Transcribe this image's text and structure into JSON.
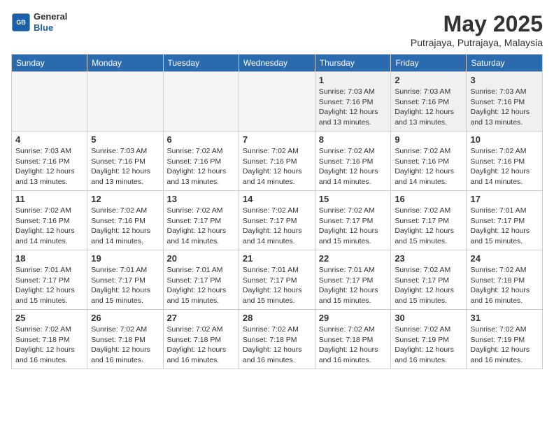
{
  "header": {
    "logo_general": "General",
    "logo_blue": "Blue",
    "month_title": "May 2025",
    "subtitle": "Putrajaya, Putrajaya, Malaysia"
  },
  "weekdays": [
    "Sunday",
    "Monday",
    "Tuesday",
    "Wednesday",
    "Thursday",
    "Friday",
    "Saturday"
  ],
  "weeks": [
    [
      {
        "day": "",
        "info": ""
      },
      {
        "day": "",
        "info": ""
      },
      {
        "day": "",
        "info": ""
      },
      {
        "day": "",
        "info": ""
      },
      {
        "day": "1",
        "info": "Sunrise: 7:03 AM\nSunset: 7:16 PM\nDaylight: 12 hours\nand 13 minutes."
      },
      {
        "day": "2",
        "info": "Sunrise: 7:03 AM\nSunset: 7:16 PM\nDaylight: 12 hours\nand 13 minutes."
      },
      {
        "day": "3",
        "info": "Sunrise: 7:03 AM\nSunset: 7:16 PM\nDaylight: 12 hours\nand 13 minutes."
      }
    ],
    [
      {
        "day": "4",
        "info": "Sunrise: 7:03 AM\nSunset: 7:16 PM\nDaylight: 12 hours\nand 13 minutes."
      },
      {
        "day": "5",
        "info": "Sunrise: 7:03 AM\nSunset: 7:16 PM\nDaylight: 12 hours\nand 13 minutes."
      },
      {
        "day": "6",
        "info": "Sunrise: 7:02 AM\nSunset: 7:16 PM\nDaylight: 12 hours\nand 13 minutes."
      },
      {
        "day": "7",
        "info": "Sunrise: 7:02 AM\nSunset: 7:16 PM\nDaylight: 12 hours\nand 14 minutes."
      },
      {
        "day": "8",
        "info": "Sunrise: 7:02 AM\nSunset: 7:16 PM\nDaylight: 12 hours\nand 14 minutes."
      },
      {
        "day": "9",
        "info": "Sunrise: 7:02 AM\nSunset: 7:16 PM\nDaylight: 12 hours\nand 14 minutes."
      },
      {
        "day": "10",
        "info": "Sunrise: 7:02 AM\nSunset: 7:16 PM\nDaylight: 12 hours\nand 14 minutes."
      }
    ],
    [
      {
        "day": "11",
        "info": "Sunrise: 7:02 AM\nSunset: 7:16 PM\nDaylight: 12 hours\nand 14 minutes."
      },
      {
        "day": "12",
        "info": "Sunrise: 7:02 AM\nSunset: 7:16 PM\nDaylight: 12 hours\nand 14 minutes."
      },
      {
        "day": "13",
        "info": "Sunrise: 7:02 AM\nSunset: 7:17 PM\nDaylight: 12 hours\nand 14 minutes."
      },
      {
        "day": "14",
        "info": "Sunrise: 7:02 AM\nSunset: 7:17 PM\nDaylight: 12 hours\nand 14 minutes."
      },
      {
        "day": "15",
        "info": "Sunrise: 7:02 AM\nSunset: 7:17 PM\nDaylight: 12 hours\nand 15 minutes."
      },
      {
        "day": "16",
        "info": "Sunrise: 7:02 AM\nSunset: 7:17 PM\nDaylight: 12 hours\nand 15 minutes."
      },
      {
        "day": "17",
        "info": "Sunrise: 7:01 AM\nSunset: 7:17 PM\nDaylight: 12 hours\nand 15 minutes."
      }
    ],
    [
      {
        "day": "18",
        "info": "Sunrise: 7:01 AM\nSunset: 7:17 PM\nDaylight: 12 hours\nand 15 minutes."
      },
      {
        "day": "19",
        "info": "Sunrise: 7:01 AM\nSunset: 7:17 PM\nDaylight: 12 hours\nand 15 minutes."
      },
      {
        "day": "20",
        "info": "Sunrise: 7:01 AM\nSunset: 7:17 PM\nDaylight: 12 hours\nand 15 minutes."
      },
      {
        "day": "21",
        "info": "Sunrise: 7:01 AM\nSunset: 7:17 PM\nDaylight: 12 hours\nand 15 minutes."
      },
      {
        "day": "22",
        "info": "Sunrise: 7:01 AM\nSunset: 7:17 PM\nDaylight: 12 hours\nand 15 minutes."
      },
      {
        "day": "23",
        "info": "Sunrise: 7:02 AM\nSunset: 7:17 PM\nDaylight: 12 hours\nand 15 minutes."
      },
      {
        "day": "24",
        "info": "Sunrise: 7:02 AM\nSunset: 7:18 PM\nDaylight: 12 hours\nand 16 minutes."
      }
    ],
    [
      {
        "day": "25",
        "info": "Sunrise: 7:02 AM\nSunset: 7:18 PM\nDaylight: 12 hours\nand 16 minutes."
      },
      {
        "day": "26",
        "info": "Sunrise: 7:02 AM\nSunset: 7:18 PM\nDaylight: 12 hours\nand 16 minutes."
      },
      {
        "day": "27",
        "info": "Sunrise: 7:02 AM\nSunset: 7:18 PM\nDaylight: 12 hours\nand 16 minutes."
      },
      {
        "day": "28",
        "info": "Sunrise: 7:02 AM\nSunset: 7:18 PM\nDaylight: 12 hours\nand 16 minutes."
      },
      {
        "day": "29",
        "info": "Sunrise: 7:02 AM\nSunset: 7:18 PM\nDaylight: 12 hours\nand 16 minutes."
      },
      {
        "day": "30",
        "info": "Sunrise: 7:02 AM\nSunset: 7:19 PM\nDaylight: 12 hours\nand 16 minutes."
      },
      {
        "day": "31",
        "info": "Sunrise: 7:02 AM\nSunset: 7:19 PM\nDaylight: 12 hours\nand 16 minutes."
      }
    ]
  ]
}
